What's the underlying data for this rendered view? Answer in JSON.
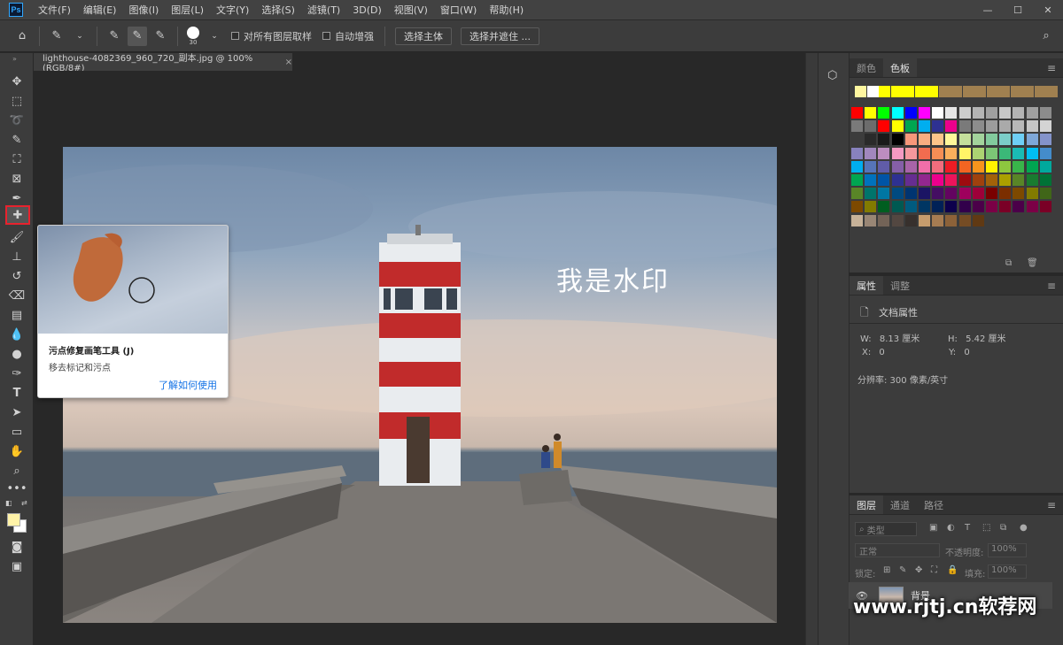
{
  "app": {
    "logo_text": "Ps"
  },
  "menu": [
    "文件(F)",
    "编辑(E)",
    "图像(I)",
    "图层(L)",
    "文字(Y)",
    "选择(S)",
    "滤镜(T)",
    "3D(D)",
    "视图(V)",
    "窗口(W)",
    "帮助(H)"
  ],
  "options": {
    "brush_size": "30",
    "sample_all_layers": "对所有图层取样",
    "auto_enhance": "自动增强",
    "select_subject": "选择主体",
    "select_and_mask": "选择并遮住 ..."
  },
  "document": {
    "tab_title": "lighthouse-4082369_960_720_副本.jpg @ 100%(RGB/8#)",
    "close_glyph": "×",
    "watermark": "我是水印"
  },
  "tooltip": {
    "title": "污点修复画笔工具 (J)",
    "description": "移去标记和污点",
    "link": "了解如何使用"
  },
  "swatches_panel": {
    "tabs": [
      "颜色",
      "色板"
    ],
    "active_tab": "色板",
    "recent": [
      "#fff7a0",
      "#ffffff",
      "#ffff00",
      "#ffff00",
      "#ffff00",
      "#ffff00",
      "#ffff00",
      "#a08050",
      "#a08050",
      "#a08050",
      "#a08050",
      "#a08050",
      "#a08050",
      "#a08050",
      "#a08050",
      "#a08050",
      "#a08050"
    ],
    "grid": [
      [
        "#ff0000",
        "#ffff00",
        "#00ff00",
        "#00ffff",
        "#0000ff",
        "#ff00ff",
        "#ffffff",
        "#e6e6e6",
        "#cdcdcd",
        "#b4b4b4",
        "#a0a0a0",
        "#c8c8c8",
        "#b4b4b4",
        "#a0a0a0",
        "#8c8c8c"
      ],
      [
        "#7a7a7a",
        "#6c6c6c",
        "#ff0000",
        "#ffff00",
        "#00a651",
        "#00aeef",
        "#2e3192",
        "#ec008c",
        "#7a7a7a",
        "#8c8c8c",
        "#9c9c9c",
        "#aaaaaa",
        "#b8b8b8",
        "#c6c6c6",
        "#d4d4d4"
      ],
      [
        "#3c3c3c",
        "#2a2a2a",
        "#1a1a1a",
        "#000000",
        "#f7977a",
        "#f9ad81",
        "#fdc68a",
        "#fff79a",
        "#c4df9b",
        "#a3d39c",
        "#82ca9d",
        "#7bcdc8",
        "#6ecff6",
        "#7ea7d8",
        "#8493ca"
      ],
      [
        "#8882be",
        "#a187be",
        "#bc8dbf",
        "#f49ac2",
        "#f6989d",
        "#f26c4f",
        "#f68e55",
        "#fbaf5c",
        "#fff467",
        "#acd372",
        "#7cc576",
        "#3bb878",
        "#1abbb4",
        "#00bff3",
        "#448ccb"
      ],
      [
        "#00aeef",
        "#5674b9",
        "#605ca8",
        "#855fa8",
        "#a864a8",
        "#f06ea9",
        "#f26d7d",
        "#ed1c24",
        "#f26522",
        "#f7941d",
        "#fff200",
        "#8dc73f",
        "#39b54a",
        "#00a651",
        "#00a99d"
      ],
      [
        "#00a651",
        "#0072bc",
        "#0054a6",
        "#2e3192",
        "#662d91",
        "#92278f",
        "#ec008c",
        "#ed145b",
        "#9e0b0f",
        "#a0410d",
        "#a36209",
        "#aba000",
        "#598527",
        "#197b30",
        "#007236"
      ],
      [
        "#598527",
        "#00746b",
        "#0076a3",
        "#004a80",
        "#003471",
        "#1b1464",
        "#440e62",
        "#630460",
        "#9e005d",
        "#9e0039",
        "#790000",
        "#7b2e00",
        "#7d4900",
        "#827b00",
        "#406618"
      ],
      [
        "#7d4900",
        "#827b00",
        "#005e20",
        "#005952",
        "#005b7f",
        "#003663",
        "#002157",
        "#0d004c",
        "#32004b",
        "#4b0049",
        "#7b0046",
        "#7a0026",
        "#4b0049",
        "#7b0046",
        "#7a0026"
      ],
      [
        "#c7b299",
        "#998675",
        "#736357",
        "#534741",
        "#37302d",
        "#c69c6d",
        "#a67c52",
        "#8c6239",
        "#754c24",
        "#603913"
      ]
    ]
  },
  "properties_panel": {
    "tabs": [
      "属性",
      "调整"
    ],
    "active_tab": "属性",
    "heading": "文档属性",
    "w_label": "W:",
    "w_value": "8.13 厘米",
    "h_label": "H:",
    "h_value": "5.42 厘米",
    "x_label": "X:",
    "x_value": "0",
    "y_label": "Y:",
    "y_value": "0",
    "resolution": "分辨率: 300 像素/英寸"
  },
  "layers_panel": {
    "tabs": [
      "图层",
      "通道",
      "路径"
    ],
    "active_tab": "图层",
    "filter_label": "类型",
    "blend_mode": "正常",
    "opacity_label": "不透明度:",
    "opacity_value": "100%",
    "lock_label": "锁定:",
    "fill_label": "填充:",
    "fill_value": "100%",
    "layer_name": "背景"
  },
  "site_watermark": "www.rjtj.cn软荐网"
}
